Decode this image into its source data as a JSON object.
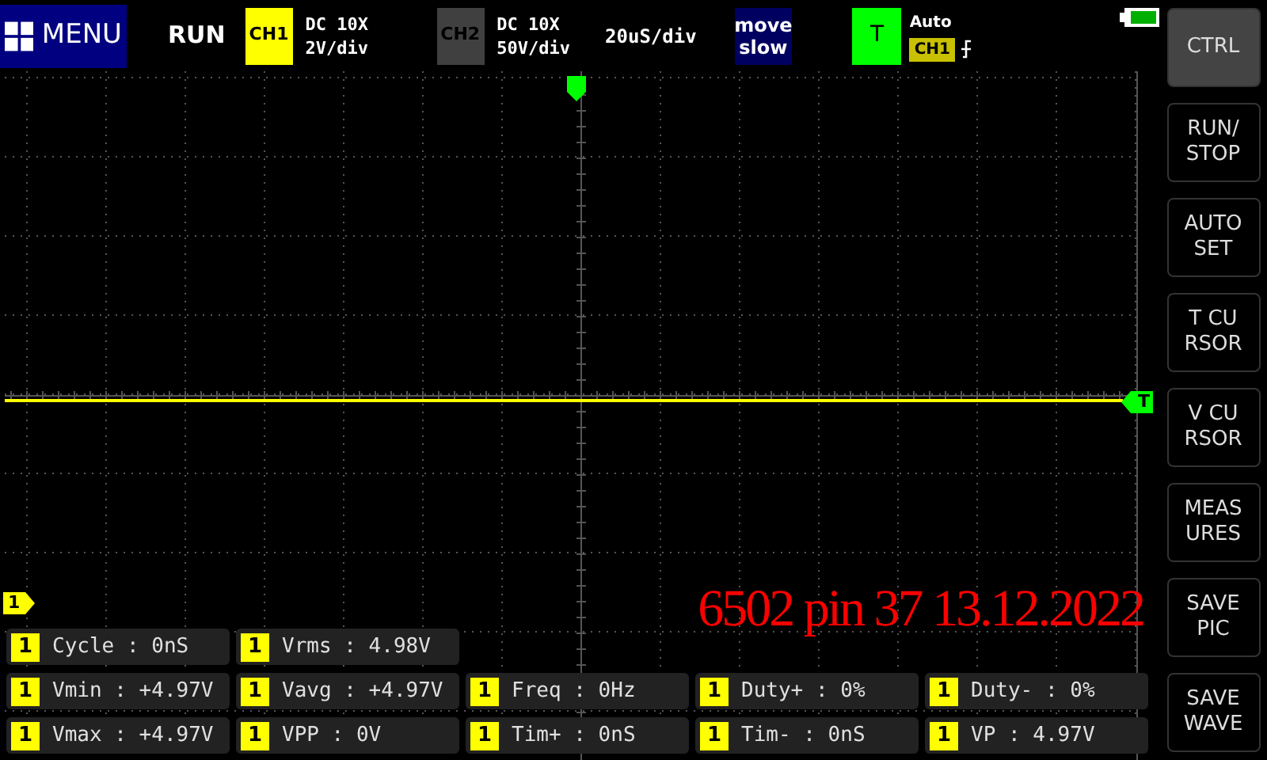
{
  "top_bar": {
    "menu_label": "MENU",
    "run_state": "RUN",
    "channels": [
      {
        "label": "CH1",
        "coupling": "DC 10X",
        "scale": "2V/div",
        "color": "#ffff00"
      },
      {
        "label": "CH2",
        "coupling": "DC 10X",
        "scale": "50V/div",
        "color": "#404040"
      }
    ],
    "timebase": "20uS/div",
    "move_button": [
      "move",
      "slow"
    ],
    "trigger": {
      "label": "T",
      "mode": "Auto",
      "source": "CH1"
    }
  },
  "plot": {
    "trigger_marker": "T",
    "channel_marker": "1",
    "annotation": "6502 pin 37 13.12.2022"
  },
  "measurements": [
    [
      {
        "channel": "1",
        "label": "Cycle :",
        "value": "0nS"
      },
      {
        "channel": "1",
        "label": "Vrms :",
        "value": "4.98V"
      }
    ],
    [
      {
        "channel": "1",
        "label": "Vmin :",
        "value": "+4.97V"
      },
      {
        "channel": "1",
        "label": "Vavg :",
        "value": "+4.97V"
      },
      {
        "channel": "1",
        "label": "Freq :",
        "value": "0Hz"
      },
      {
        "channel": "1",
        "label": "Duty+ :",
        "value": "0%"
      },
      {
        "channel": "1",
        "label": "Duty- :",
        "value": "0%"
      }
    ],
    [
      {
        "channel": "1",
        "label": "Vmax :",
        "value": "+4.97V"
      },
      {
        "channel": "1",
        "label": "VPP :",
        "value": "0V"
      },
      {
        "channel": "1",
        "label": "Tim+ :",
        "value": "0nS"
      },
      {
        "channel": "1",
        "label": "Tim- :",
        "value": "0nS"
      },
      {
        "channel": "1",
        "label": "VP :",
        "value": "4.97V"
      }
    ]
  ],
  "side_buttons": [
    {
      "lines": [
        "CTRL"
      ],
      "selected": true
    },
    {
      "lines": [
        "RUN/",
        "STOP"
      ],
      "selected": false
    },
    {
      "lines": [
        "AUTO",
        "SET"
      ],
      "selected": false
    },
    {
      "lines": [
        "T CU",
        "RSOR"
      ],
      "selected": false
    },
    {
      "lines": [
        "V CU",
        "RSOR"
      ],
      "selected": false
    },
    {
      "lines": [
        "MEAS",
        "URES"
      ],
      "selected": false
    },
    {
      "lines": [
        "SAVE",
        "PIC"
      ],
      "selected": false
    },
    {
      "lines": [
        "SAVE",
        "WAVE"
      ],
      "selected": false
    }
  ]
}
